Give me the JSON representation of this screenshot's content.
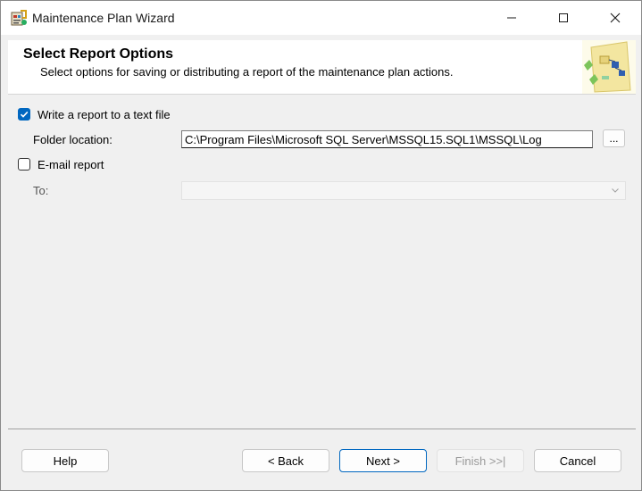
{
  "window": {
    "title": "Maintenance Plan Wizard"
  },
  "header": {
    "title": "Select Report Options",
    "subtitle": "Select options for saving or distributing a report of the maintenance plan actions."
  },
  "options": {
    "write_report": {
      "label": "Write a report to a text file",
      "checked": true
    },
    "folder_location": {
      "label": "Folder location:",
      "value": "C:\\Program Files\\Microsoft SQL Server\\MSSQL15.SQL1\\MSSQL\\Log",
      "browse_label": "..."
    },
    "email_report": {
      "label": "E-mail report",
      "checked": false
    },
    "to": {
      "label": "To:",
      "value": ""
    }
  },
  "buttons": {
    "help": "Help",
    "back": "< Back",
    "next": "Next >",
    "finish": "Finish >>|",
    "cancel": "Cancel"
  },
  "colors": {
    "accent": "#0067c0",
    "dialog_bg": "#f0f0f0"
  }
}
